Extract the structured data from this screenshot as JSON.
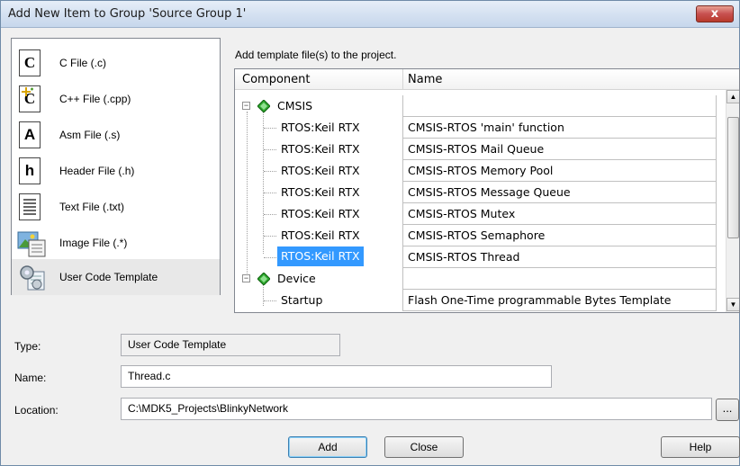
{
  "window": {
    "title": "Add New Item to Group 'Source Group 1'",
    "close_label": "x"
  },
  "file_types": [
    {
      "label": "C File (.c)",
      "icon": "c-file-icon",
      "glyph": "C"
    },
    {
      "label": "C++ File (.cpp)",
      "icon": "cpp-file-icon",
      "glyph": "C"
    },
    {
      "label": "Asm File (.s)",
      "icon": "asm-file-icon",
      "glyph": "A"
    },
    {
      "label": "Header File (.h)",
      "icon": "header-file-icon",
      "glyph": "h"
    },
    {
      "label": "Text File (.txt)",
      "icon": "text-file-icon",
      "glyph": ""
    },
    {
      "label": "Image File (.*)",
      "icon": "image-file-icon",
      "glyph": ""
    },
    {
      "label": "User Code Template",
      "icon": "template-gear-icon",
      "glyph": ""
    }
  ],
  "selected_file_type": "User Code Template",
  "template": {
    "hint": "Add template file(s) to the project.",
    "columns": {
      "component": "Component",
      "name": "Name"
    },
    "rows": [
      {
        "component": "CMSIS",
        "name": "",
        "group": true,
        "expander": "−"
      },
      {
        "component": "RTOS:Keil RTX",
        "name": "CMSIS-RTOS 'main' function"
      },
      {
        "component": "RTOS:Keil RTX",
        "name": "CMSIS-RTOS Mail Queue"
      },
      {
        "component": "RTOS:Keil RTX",
        "name": "CMSIS-RTOS Memory Pool"
      },
      {
        "component": "RTOS:Keil RTX",
        "name": "CMSIS-RTOS Message Queue"
      },
      {
        "component": "RTOS:Keil RTX",
        "name": "CMSIS-RTOS Mutex"
      },
      {
        "component": "RTOS:Keil RTX",
        "name": "CMSIS-RTOS Semaphore"
      },
      {
        "component": "RTOS:Keil RTX",
        "name": "CMSIS-RTOS Thread",
        "selected": true
      },
      {
        "component": "Device",
        "name": "",
        "group": true,
        "expander": "−"
      },
      {
        "component": "Startup",
        "name": "Flash One-Time programmable Bytes Template"
      }
    ],
    "scroll_up": "▲",
    "scroll_down": "▼"
  },
  "form": {
    "type_label": "Type:",
    "type_value": "User Code Template",
    "name_label": "Name:",
    "name_value": "Thread.c",
    "location_label": "Location:",
    "location_value": "C:\\MDK5_Projects\\BlinkyNetwork",
    "browse_label": "..."
  },
  "buttons": {
    "add": "Add",
    "close": "Close",
    "help": "Help"
  },
  "colors": {
    "selection": "#3399ff",
    "diamond": "#2ea82e"
  }
}
